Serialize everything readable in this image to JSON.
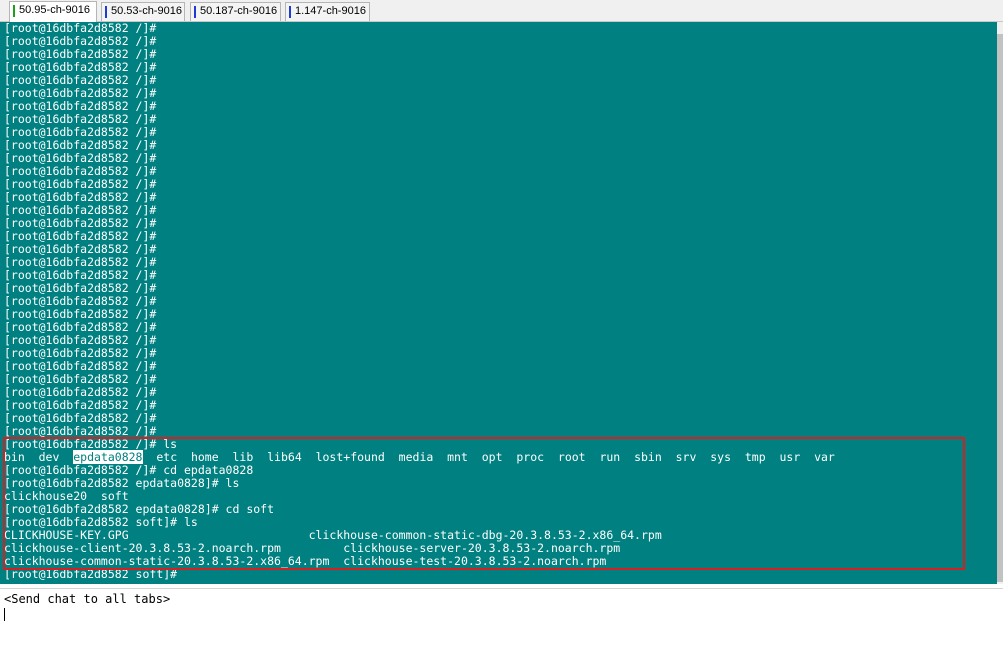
{
  "tabs": [
    {
      "label": "50.95-ch-9016",
      "mark_color": "#1ea01e",
      "active": true
    },
    {
      "label": "50.53-ch-9016",
      "mark_color": "#1e3cd2",
      "active": false
    },
    {
      "label": "50.187-ch-9016",
      "mark_color": "#1e3cd2",
      "active": false
    },
    {
      "label": "1.147-ch-9016",
      "mark_color": "#1e3cd2",
      "active": false
    }
  ],
  "terminal": {
    "background": "#008080",
    "foreground": "#ffffff",
    "highlight_color": "#d81e1e",
    "prompt_lines": [
      "[root@16dbfa2d8582 /]#",
      "[root@16dbfa2d8582 /]#",
      "[root@16dbfa2d8582 /]#",
      "[root@16dbfa2d8582 /]#",
      "[root@16dbfa2d8582 /]#",
      "[root@16dbfa2d8582 /]#",
      "[root@16dbfa2d8582 /]#",
      "[root@16dbfa2d8582 /]#",
      "[root@16dbfa2d8582 /]#",
      "[root@16dbfa2d8582 /]#",
      "[root@16dbfa2d8582 /]#",
      "[root@16dbfa2d8582 /]#",
      "[root@16dbfa2d8582 /]#",
      "[root@16dbfa2d8582 /]#",
      "[root@16dbfa2d8582 /]#",
      "[root@16dbfa2d8582 /]#",
      "[root@16dbfa2d8582 /]#",
      "[root@16dbfa2d8582 /]#",
      "[root@16dbfa2d8582 /]#",
      "[root@16dbfa2d8582 /]#",
      "[root@16dbfa2d8582 /]#",
      "[root@16dbfa2d8582 /]#",
      "[root@16dbfa2d8582 /]#",
      "[root@16dbfa2d8582 /]#",
      "[root@16dbfa2d8582 /]#",
      "[root@16dbfa2d8582 /]#",
      "[root@16dbfa2d8582 /]#",
      "[root@16dbfa2d8582 /]#",
      "[root@16dbfa2d8582 /]#",
      "[root@16dbfa2d8582 /]#",
      "[root@16dbfa2d8582 /]#",
      "[root@16dbfa2d8582 /]#"
    ],
    "cmd1": "[root@16dbfa2d8582 /]# ls",
    "ls_root_pre": "bin  dev  ",
    "ls_root_selected": "epdata0828",
    "ls_root_post": "  etc  home  lib  lib64  lost+found  media  mnt  opt  proc  root  run  sbin  srv  sys  tmp  usr  var",
    "cmd2": "[root@16dbfa2d8582 /]# cd epdata0828",
    "cmd3": "[root@16dbfa2d8582 epdata0828]# ls",
    "ls_epdata": "clickhouse20  soft",
    "cmd4": "[root@16dbfa2d8582 epdata0828]# cd soft",
    "cmd5": "[root@16dbfa2d8582 soft]# ls",
    "files_row1": "CLICKHOUSE-KEY.GPG                          clickhouse-common-static-dbg-20.3.8.53-2.x86_64.rpm",
    "files_row2": "clickhouse-client-20.3.8.53-2.noarch.rpm         clickhouse-server-20.3.8.53-2.noarch.rpm",
    "files_row3": "clickhouse-common-static-20.3.8.53-2.x86_64.rpm  clickhouse-test-20.3.8.53-2.noarch.rpm",
    "final_prompt": "[root@16dbfa2d8582 soft]#"
  },
  "chat": {
    "placeholder": "<Send chat to all tabs>"
  }
}
